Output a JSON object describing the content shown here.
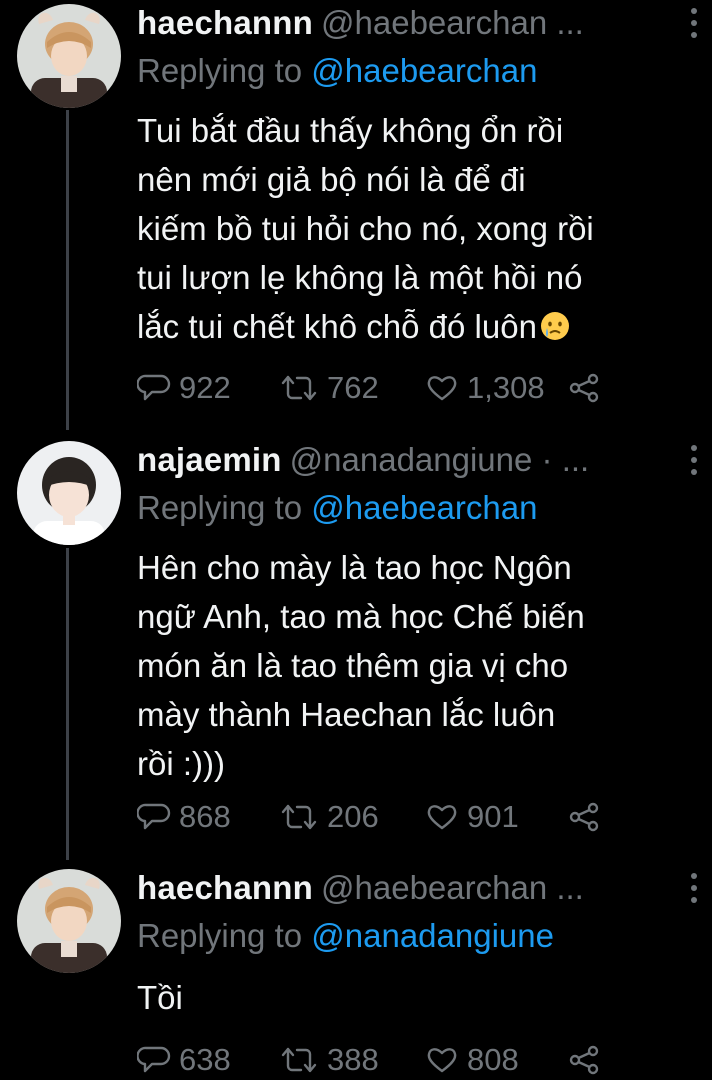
{
  "colors": {
    "background": "#000000",
    "name": "#f1f3f4",
    "muted": "#71767b",
    "mention": "#1d9bf0",
    "thread_line": "#3d4148"
  },
  "tweets": [
    {
      "display_name": "haechannn",
      "handle": "@haebearchan ...",
      "replying_prefix": "Replying to ",
      "replying_to": "@haebearchan",
      "text_lines": [
        "Tui bắt đầu thấy không ổn rồi",
        "nên mới giả bộ nói là để đi",
        "kiếm bồ tui hỏi cho nó, xong rồi",
        "tui lượn lẹ không là một hồi nó",
        "lắc tui chết khô chỗ đó luôn"
      ],
      "emoji": "crying-face-emoji",
      "replies": "922",
      "retweets": "762",
      "likes": "1,308"
    },
    {
      "display_name": "najaemin",
      "handle": "@nanadangiune · ...",
      "replying_prefix": "Replying to ",
      "replying_to": "@haebearchan",
      "text_lines": [
        "Hên cho mày là tao học Ngôn",
        "ngữ Anh, tao mà học Chế biến",
        "món ăn là tao thêm gia vị cho",
        "mày thành Haechan lắc luôn",
        "rồi :)))"
      ],
      "replies": "868",
      "retweets": "206",
      "likes": "901"
    },
    {
      "display_name": "haechannn",
      "handle": "@haebearchan ...",
      "replying_prefix": "Replying to ",
      "replying_to": "@nanadangiune",
      "text_lines": [
        "Tồi"
      ],
      "replies": "638",
      "retweets": "388",
      "likes": "808"
    }
  ]
}
